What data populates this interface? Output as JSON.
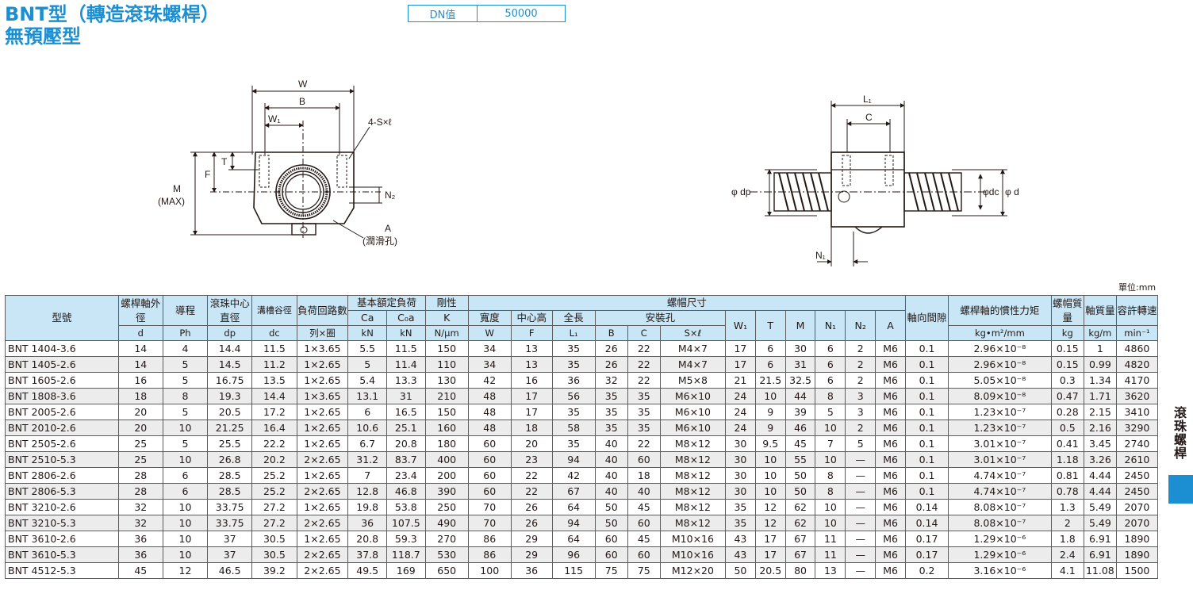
{
  "title": {
    "line1": "BNT型（轉造滾珠螺桿）",
    "line2": "無預壓型"
  },
  "dn_box": {
    "key": "DN值",
    "value": "50000"
  },
  "unit_label": "單位:mm",
  "side_tab": "滾珠螺桿",
  "drawing_front": {
    "W": "W",
    "B": "B",
    "W1": "W₁",
    "hole": "4-S×ℓ",
    "T": "T",
    "F": "F",
    "M": "M",
    "Mmax": "(MAX)",
    "N2": "N₂",
    "A": "A",
    "lube": "(潤滑孔)"
  },
  "drawing_side": {
    "L1": "L₁",
    "C": "C",
    "dp": "φ dp",
    "dc": "φdc",
    "d": "φ d",
    "N1": "N₁"
  },
  "table": {
    "header": {
      "model": "型號",
      "shaft_od": "螺桿軸外徑",
      "lead": "導程",
      "ball_dia": "滾珠中心直徑",
      "root_dia": "溝槽谷徑",
      "circuits": "負荷回路數",
      "load_group": "基本額定負荷",
      "rigidity": "剛性",
      "nut_group": "螺帽尺寸",
      "width": "寬度",
      "center": "中心高",
      "length": "全長",
      "mount": "安裝孔",
      "axial": "軸向間隙",
      "inertia": "螺桿軸的慣性力矩",
      "nut_mass": "螺帽質量",
      "shaft_mass": "軸質量",
      "speed": "容許轉速"
    },
    "sub": {
      "d": "d",
      "Ph": "Ph",
      "dp": "dp",
      "dc": "dc",
      "circ": "列×圈",
      "Ca": "Ca",
      "C0a": "C₀a",
      "K": "K",
      "W": "W",
      "F": "F",
      "L1": "L₁",
      "B": "B",
      "C": "C",
      "Sl": "S×ℓ",
      "W1": "W₁",
      "T": "T",
      "M": "M",
      "N1": "N₁",
      "N2": "N₂",
      "A": "A"
    },
    "units": {
      "Ca": "kN",
      "C0a": "kN",
      "K": "N/μm",
      "inertia": "kg•m²/mm",
      "nut_mass": "kg",
      "shaft_mass": "kg/m",
      "speed": "min⁻¹"
    },
    "rows": [
      [
        "BNT 1404-3.6",
        "14",
        "4",
        "14.4",
        "11.5",
        "1×3.65",
        "5.5",
        "11.5",
        "150",
        "34",
        "13",
        "35",
        "26",
        "22",
        "M4×7",
        "17",
        "6",
        "30",
        "6",
        "2",
        "M6",
        "0.1",
        "2.96×10⁻⁸",
        "0.15",
        "1",
        "4860"
      ],
      [
        "BNT 1405-2.6",
        "14",
        "5",
        "14.5",
        "11.2",
        "1×2.65",
        "5",
        "11.4",
        "110",
        "34",
        "13",
        "35",
        "26",
        "22",
        "M4×7",
        "17",
        "6",
        "31",
        "6",
        "2",
        "M6",
        "0.1",
        "2.96×10⁻⁸",
        "0.15",
        "0.99",
        "4820"
      ],
      [
        "BNT 1605-2.6",
        "16",
        "5",
        "16.75",
        "13.5",
        "1×2.65",
        "5.4",
        "13.3",
        "130",
        "42",
        "16",
        "36",
        "32",
        "22",
        "M5×8",
        "21",
        "21.5",
        "32.5",
        "6",
        "2",
        "M6",
        "0.1",
        "5.05×10⁻⁸",
        "0.3",
        "1.34",
        "4170"
      ],
      [
        "BNT 1808-3.6",
        "18",
        "8",
        "19.3",
        "14.4",
        "1×3.65",
        "13.1",
        "31",
        "210",
        "48",
        "17",
        "56",
        "35",
        "35",
        "M6×10",
        "24",
        "10",
        "44",
        "8",
        "3",
        "M6",
        "0.1",
        "8.09×10⁻⁸",
        "0.47",
        "1.71",
        "3620"
      ],
      [
        "BNT 2005-2.6",
        "20",
        "5",
        "20.5",
        "17.2",
        "1×2.65",
        "6",
        "16.5",
        "150",
        "48",
        "17",
        "35",
        "35",
        "35",
        "M6×10",
        "24",
        "9",
        "39",
        "5",
        "3",
        "M6",
        "0.1",
        "1.23×10⁻⁷",
        "0.28",
        "2.15",
        "3410"
      ],
      [
        "BNT 2010-2.6",
        "20",
        "10",
        "21.25",
        "16.4",
        "1×2.65",
        "10.6",
        "25.1",
        "160",
        "48",
        "18",
        "58",
        "35",
        "35",
        "M6×10",
        "24",
        "9",
        "46",
        "10",
        "2",
        "M6",
        "0.1",
        "1.23×10⁻⁷",
        "0.5",
        "2.16",
        "3290"
      ],
      [
        "BNT 2505-2.6",
        "25",
        "5",
        "25.5",
        "22.2",
        "1×2.65",
        "6.7",
        "20.8",
        "180",
        "60",
        "20",
        "35",
        "40",
        "22",
        "M8×12",
        "30",
        "9.5",
        "45",
        "7",
        "5",
        "M6",
        "0.1",
        "3.01×10⁻⁷",
        "0.41",
        "3.45",
        "2740"
      ],
      [
        "BNT 2510-5.3",
        "25",
        "10",
        "26.8",
        "20.2",
        "2×2.65",
        "31.2",
        "83.7",
        "400",
        "60",
        "23",
        "94",
        "40",
        "60",
        "M8×12",
        "30",
        "10",
        "55",
        "10",
        "—",
        "M6",
        "0.1",
        "3.01×10⁻⁷",
        "1.18",
        "3.26",
        "2610"
      ],
      [
        "BNT 2806-2.6",
        "28",
        "6",
        "28.5",
        "25.2",
        "1×2.65",
        "7",
        "23.4",
        "200",
        "60",
        "22",
        "42",
        "40",
        "18",
        "M8×12",
        "30",
        "10",
        "50",
        "8",
        "—",
        "M6",
        "0.1",
        "4.74×10⁻⁷",
        "0.81",
        "4.44",
        "2450"
      ],
      [
        "BNT 2806-5.3",
        "28",
        "6",
        "28.5",
        "25.2",
        "2×2.65",
        "12.8",
        "46.8",
        "390",
        "60",
        "22",
        "67",
        "40",
        "40",
        "M8×12",
        "30",
        "10",
        "50",
        "8",
        "—",
        "M6",
        "0.1",
        "4.74×10⁻⁷",
        "0.78",
        "4.44",
        "2450"
      ],
      [
        "BNT 3210-2.6",
        "32",
        "10",
        "33.75",
        "27.2",
        "1×2.65",
        "19.8",
        "53.8",
        "250",
        "70",
        "26",
        "64",
        "50",
        "45",
        "M8×12",
        "35",
        "12",
        "62",
        "10",
        "—",
        "M6",
        "0.14",
        "8.08×10⁻⁷",
        "1.3",
        "5.49",
        "2070"
      ],
      [
        "BNT 3210-5.3",
        "32",
        "10",
        "33.75",
        "27.2",
        "2×2.65",
        "36",
        "107.5",
        "490",
        "70",
        "26",
        "94",
        "50",
        "60",
        "M8×12",
        "35",
        "12",
        "62",
        "10",
        "—",
        "M6",
        "0.14",
        "8.08×10⁻⁷",
        "2",
        "5.49",
        "2070"
      ],
      [
        "BNT 3610-2.6",
        "36",
        "10",
        "37",
        "30.5",
        "1×2.65",
        "20.8",
        "59.3",
        "270",
        "86",
        "29",
        "64",
        "60",
        "45",
        "M10×16",
        "43",
        "17",
        "67",
        "11",
        "—",
        "M6",
        "0.17",
        "1.29×10⁻⁶",
        "1.8",
        "6.91",
        "1890"
      ],
      [
        "BNT 3610-5.3",
        "36",
        "10",
        "37",
        "30.5",
        "2×2.65",
        "37.8",
        "118.7",
        "530",
        "86",
        "29",
        "96",
        "60",
        "60",
        "M10×16",
        "43",
        "17",
        "67",
        "11",
        "—",
        "M6",
        "0.17",
        "1.29×10⁻⁶",
        "2.4",
        "6.91",
        "1890"
      ],
      [
        "BNT 4512-5.3",
        "45",
        "12",
        "46.5",
        "39.2",
        "2×2.65",
        "49.5",
        "169",
        "650",
        "100",
        "36",
        "115",
        "75",
        "75",
        "M12×20",
        "50",
        "20.5",
        "80",
        "13",
        "—",
        "M6",
        "0.2",
        "3.16×10⁻⁶",
        "4.1",
        "11.08",
        "1500"
      ]
    ]
  }
}
